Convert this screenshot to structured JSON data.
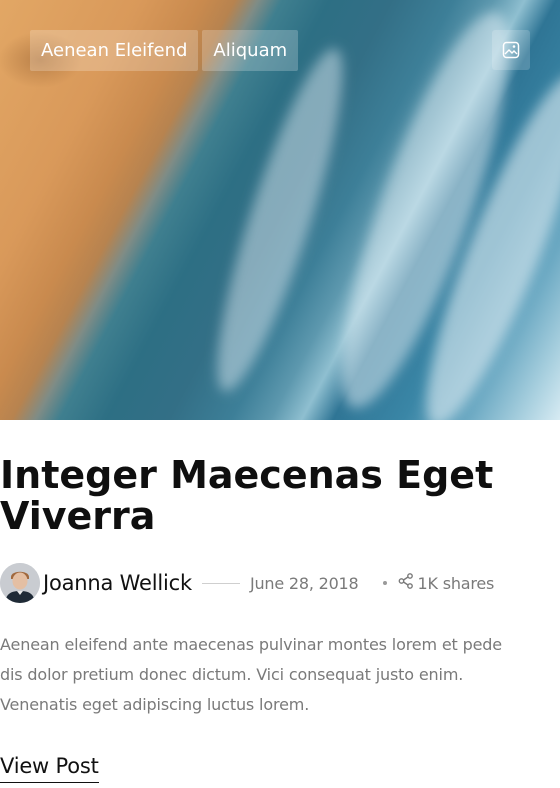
{
  "post": {
    "tags": [
      "Aenean Eleifend",
      "Aliquam"
    ],
    "media_icon": "image-icon",
    "title_line1": "Integer Maecenas Eget",
    "title_line2": "Viverra",
    "author": "Joanna Wellick",
    "date": "June 28, 2018",
    "shares": "1K shares",
    "share_icon": "share-icon",
    "excerpt_line1": "Aenean eleifend ante maecenas pulvinar montes lorem et pede",
    "excerpt_line2": "dis dolor pretium donec dictum. Vici consequat justo enim.",
    "excerpt_line3": "Venenatis eget adipiscing luctus lorem.",
    "cta": "View Post"
  },
  "colors": {
    "title": "#0f0f0f",
    "muted": "#7a7a7a",
    "tag_text": "#ffffff"
  }
}
